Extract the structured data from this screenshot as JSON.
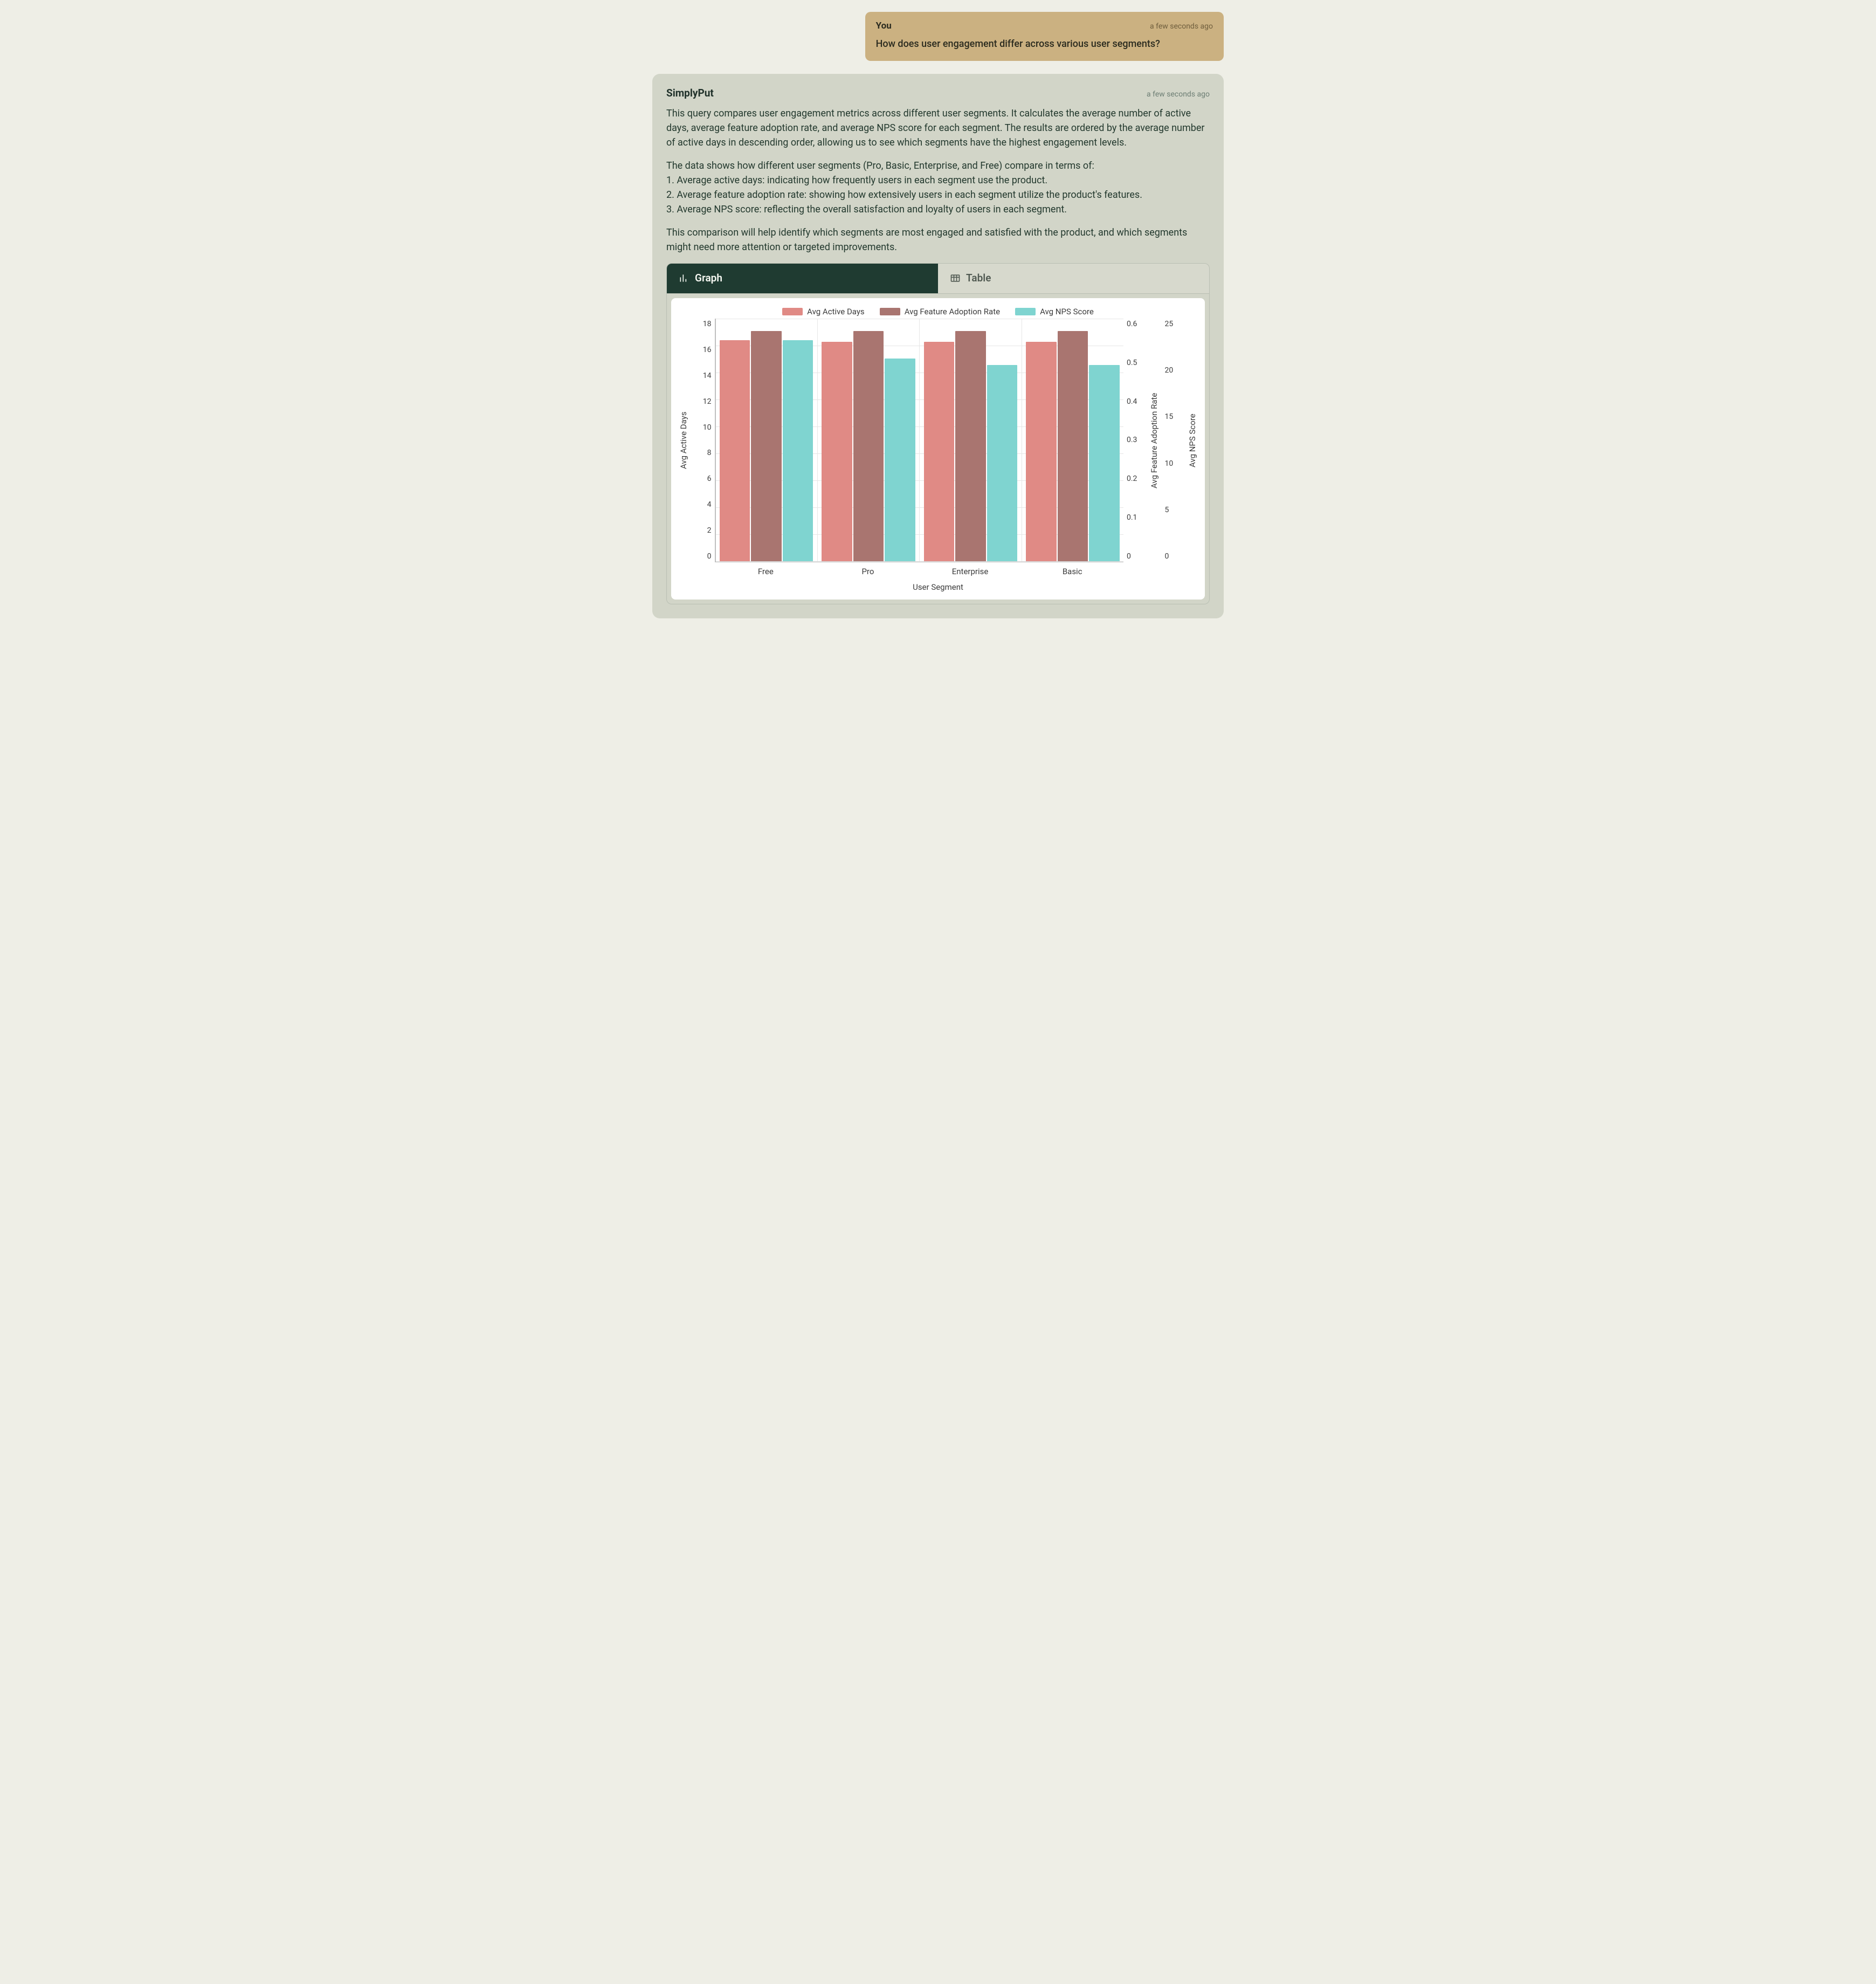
{
  "user_message": {
    "sender": "You",
    "timestamp": "a few seconds ago",
    "text": "How does user engagement differ across various user segments?"
  },
  "assistant_message": {
    "sender": "SimplyPut",
    "timestamp": "a few seconds ago",
    "para1": "This query compares user engagement metrics across different user segments. It calculates the average number of active days, average feature adoption rate, and average NPS score for each segment. The results are ordered by the average number of active days in descending order, allowing us to see which segments have the highest engagement levels.",
    "para2_intro": "The data shows how different user segments (Pro, Basic, Enterprise, and Free) compare in terms of:",
    "bullet1": "1. Average active days: indicating how frequently users in each segment use the product.",
    "bullet2": "2. Average feature adoption rate: showing how extensively users in each segment utilize the product's features.",
    "bullet3": "3. Average NPS score: reflecting the overall satisfaction and loyalty of users in each segment.",
    "para3": "This comparison will help identify which segments are most engaged and satisfied with the product, and which segments might need more attention or targeted improvements."
  },
  "tabs": {
    "graph": "Graph",
    "table": "Table"
  },
  "chart_data": {
    "type": "bar",
    "categories": [
      "Free",
      "Pro",
      "Enterprise",
      "Basic"
    ],
    "series": [
      {
        "name": "Avg Active Days",
        "axis": "y_left",
        "color": "#e08a85",
        "values": [
          16.4,
          16.3,
          16.3,
          16.3
        ]
      },
      {
        "name": "Avg Feature Adoption Rate",
        "axis": "y_right1",
        "color": "#a97570",
        "values": [
          0.57,
          0.57,
          0.57,
          0.57
        ]
      },
      {
        "name": "Avg NPS Score",
        "axis": "y_right2",
        "color": "#7fd4d0",
        "values": [
          22.8,
          20.9,
          20.2,
          20.2
        ]
      }
    ],
    "xlabel": "User Segment",
    "y_left": {
      "label": "Avg Active Days",
      "min": 0,
      "max": 18,
      "ticks": [
        18,
        16,
        14,
        12,
        10,
        8,
        6,
        4,
        2,
        0
      ]
    },
    "y_right1": {
      "label": "Avg Feature Adoption Rate",
      "min": 0,
      "max": 0.6,
      "ticks": [
        "0.6",
        "0.5",
        "0.4",
        "0.3",
        "0.2",
        "0.1",
        "0"
      ]
    },
    "y_right2": {
      "label": "Avg NPS Score",
      "min": 0,
      "max": 25,
      "ticks": [
        25,
        20,
        15,
        10,
        5,
        0
      ]
    }
  }
}
